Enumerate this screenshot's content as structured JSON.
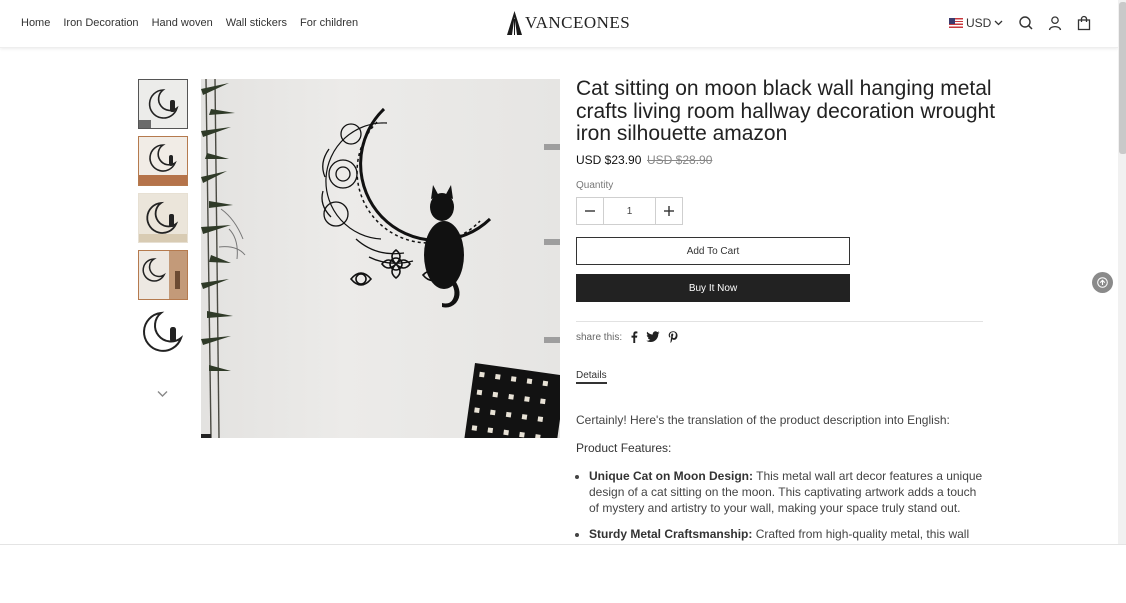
{
  "header": {
    "nav": [
      "Home",
      "Iron Decoration",
      "Hand woven",
      "Wall stickers",
      "For children"
    ],
    "logo_text": "VANCEONES",
    "currency": "USD",
    "icons": [
      "search-icon",
      "account-icon",
      "cart-icon"
    ]
  },
  "gallery": {
    "thumbnails": [
      "moon-cat-thumb-1",
      "moon-cat-thumb-2",
      "moon-cat-thumb-3",
      "moon-cat-thumb-4",
      "moon-cat-thumb-5"
    ],
    "active_index": 0
  },
  "product": {
    "title": "Cat sitting on moon black wall hanging metal crafts living room hallway decoration wrought iron silhouette amazon",
    "price": "USD $23.90",
    "compare_price": "USD $28.90",
    "quantity_label": "Quantity",
    "quantity": "1",
    "add_to_cart": "Add To Cart",
    "buy_now": "Buy It Now",
    "share_label": "share this:",
    "share_icons": [
      "facebook-icon",
      "twitter-icon",
      "pinterest-icon"
    ],
    "details_tab": "Details"
  },
  "description": {
    "intro": "Certainly! Here's the translation of the product description into English:",
    "features_heading": "Product Features:",
    "features": [
      {
        "title": "Unique Cat on Moon Design:",
        "text": " This metal wall art decor features a unique design of a cat sitting on the moon. This captivating artwork adds a touch of mystery and artistry to your wall, making your space truly stand out."
      },
      {
        "title": "Sturdy Metal Craftsmanship:",
        "text": " Crafted from high-quality metal, this wall decor is made to withstand time, ensuring it remains as beautiful as ever."
      }
    ]
  },
  "colors": {
    "text": "#222222",
    "button_dark": "#222222",
    "muted": "#888888"
  }
}
